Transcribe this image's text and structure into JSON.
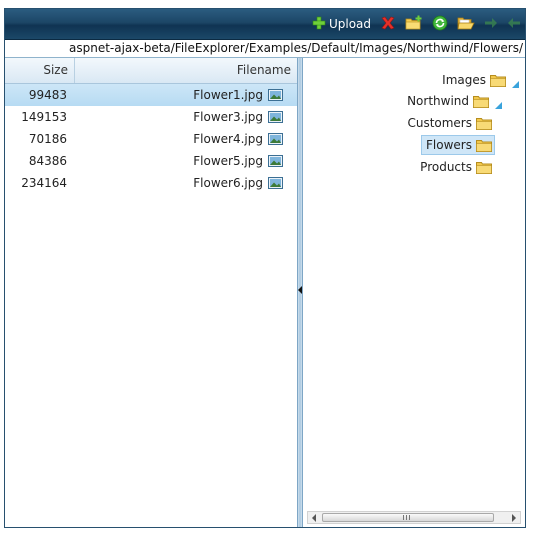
{
  "toolbar": {
    "upload_label": "Upload",
    "buttons": [
      "add-icon",
      "delete-icon",
      "new-folder-icon",
      "refresh-icon",
      "open-folder-icon",
      "forward-icon",
      "back-icon"
    ]
  },
  "address": {
    "path": "aspnet-ajax-beta/FileExplorer/Examples/Default/Images/Northwind/Flowers/"
  },
  "grid": {
    "columns": {
      "size": "Size",
      "filename": "Filename"
    },
    "rows": [
      {
        "size": "99483",
        "filename": "Flower1.jpg"
      },
      {
        "size": "149153",
        "filename": "Flower3.jpg"
      },
      {
        "size": "70186",
        "filename": "Flower4.jpg"
      },
      {
        "size": "84386",
        "filename": "Flower5.jpg"
      },
      {
        "size": "234164",
        "filename": "Flower6.jpg"
      }
    ]
  },
  "tree": {
    "nodes": [
      {
        "label": "Images"
      },
      {
        "label": "Northwind"
      },
      {
        "label": "Customers"
      },
      {
        "label": "Flowers"
      },
      {
        "label": "Products"
      }
    ]
  },
  "colors": {
    "toolbar": "#1c4666",
    "selection": "#cde6f7",
    "folder": "#f2c84b"
  }
}
